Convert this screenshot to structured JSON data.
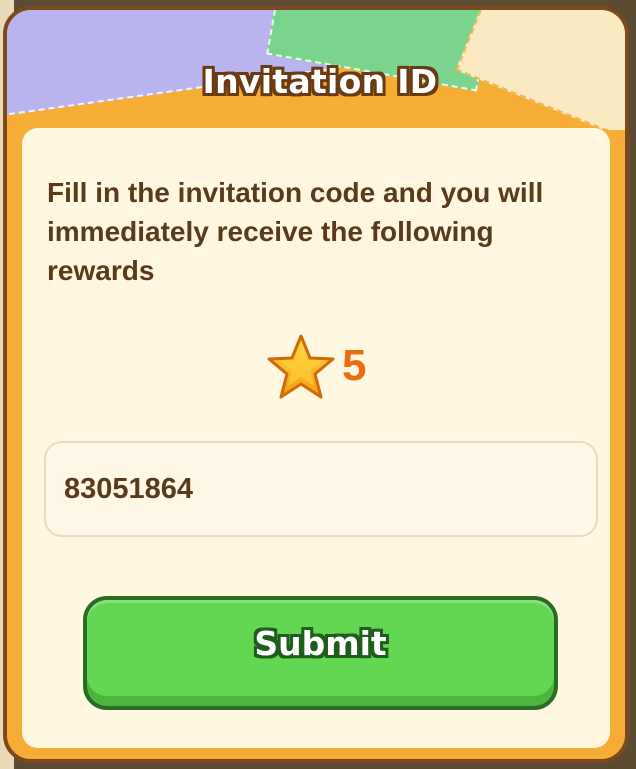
{
  "dialog": {
    "title": "Invitation ID",
    "description": "Fill in the invitation code and you will immediately receive the following rewards",
    "reward": {
      "icon": "star-icon",
      "amount": "5"
    },
    "invitation_input": {
      "value": "83051864"
    },
    "submit_label": "Submit"
  },
  "colors": {
    "frame": "#f6ad36",
    "frame_border": "#7a4a1e",
    "panel": "#fff7df",
    "text": "#5a3a1c",
    "reward_amount": "#ee6c10",
    "submit": "#63d652",
    "submit_border": "#2c6b26"
  }
}
